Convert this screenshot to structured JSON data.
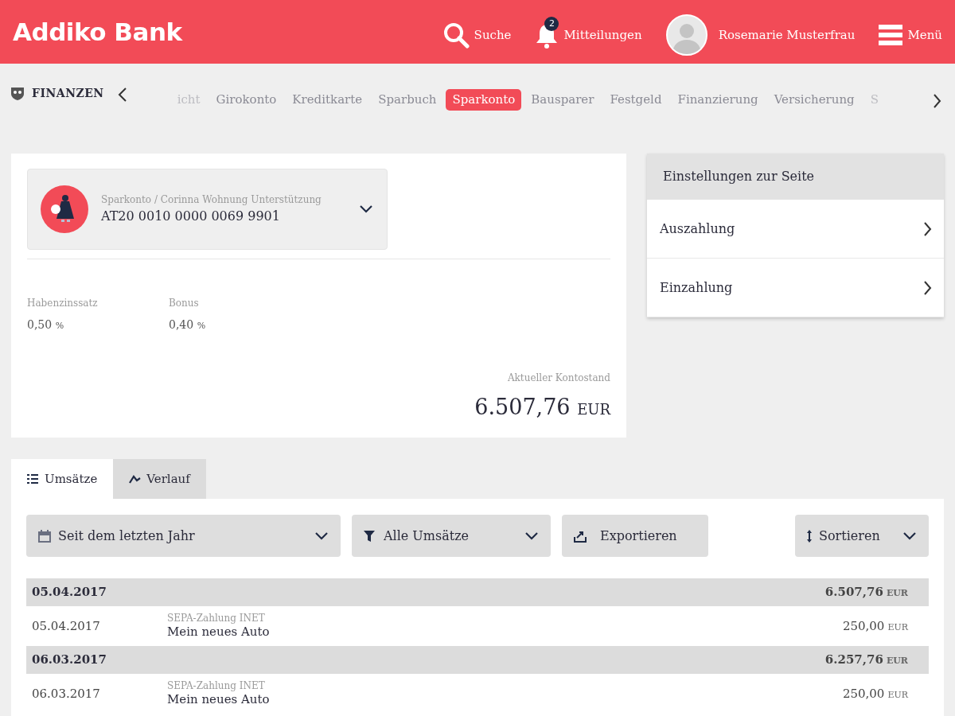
{
  "header": {
    "logo": "Addiko Bank",
    "search": "Suche",
    "notifications": {
      "label": "Mitteilungen",
      "count": "2"
    },
    "user": "Rosemarie Musterfrau",
    "menu": "Menü"
  },
  "section": {
    "title": "FINANZEN",
    "tabs": [
      {
        "label": "icht",
        "selected": false
      },
      {
        "label": "Girokonto",
        "selected": false
      },
      {
        "label": "Kreditkarte",
        "selected": false
      },
      {
        "label": "Sparbuch",
        "selected": false
      },
      {
        "label": "Sparkonto",
        "selected": true
      },
      {
        "label": "Bausparer",
        "selected": false
      },
      {
        "label": "Festgeld",
        "selected": false
      },
      {
        "label": "Finanzierung",
        "selected": false
      },
      {
        "label": "Versicherung",
        "selected": false
      },
      {
        "label": "S",
        "selected": false
      }
    ]
  },
  "account": {
    "subtitle": "Sparkonto / Corinna Wohnung Unterstützung",
    "iban": "AT20 0010 0000 0069 9901",
    "rates": [
      {
        "label": "Habenzinssatz",
        "value": "0,50",
        "unit": "%"
      },
      {
        "label": "Bonus",
        "value": "0,40",
        "unit": "%"
      }
    ],
    "balance": {
      "label": "Aktueller Kontostand",
      "amount": "6.507,76",
      "currency": "EUR"
    }
  },
  "settings": {
    "title": "Einstellungen zur Seite",
    "items": [
      "Auszahlung",
      "Einzahlung"
    ]
  },
  "view_tabs": [
    {
      "label": "Umsätze",
      "selected": true
    },
    {
      "label": "Verlauf",
      "selected": false
    }
  ],
  "filters": [
    {
      "kind": "dropdown",
      "label": "Seit dem letzten Jahr"
    },
    {
      "kind": "dropdown",
      "label": "Alle Umsätze"
    },
    {
      "kind": "button",
      "label": "Exportieren"
    },
    {
      "kind": "dropdown",
      "label": "Sortieren"
    }
  ],
  "transactions": [
    {
      "date": "05.04.2017",
      "balance": "6.507,76",
      "currency": "EUR",
      "items": [
        {
          "date": "05.04.2017",
          "type": "SEPA-Zahlung INET",
          "text": "Mein neues Auto",
          "amount": "250,00",
          "currency": "EUR"
        }
      ]
    },
    {
      "date": "06.03.2017",
      "balance": "6.257,76",
      "currency": "EUR",
      "items": [
        {
          "date": "06.03.2017",
          "type": "SEPA-Zahlung INET",
          "text": "Mein neues Auto",
          "amount": "250,00",
          "currency": "EUR"
        }
      ]
    }
  ]
}
